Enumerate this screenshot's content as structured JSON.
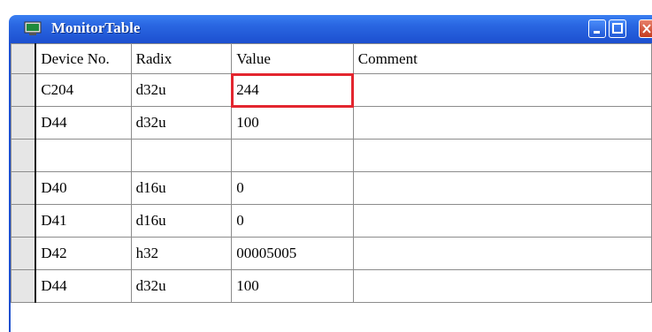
{
  "window": {
    "title": "MonitorTable",
    "accent": "#2a67e2"
  },
  "columns": [
    "Device No.",
    "Radix",
    "Value",
    "Comment"
  ],
  "rows": [
    {
      "device": "C204",
      "radix": "d32u",
      "value": "244",
      "comment": ""
    },
    {
      "device": "D44",
      "radix": "d32u",
      "value": "100",
      "comment": ""
    },
    {
      "device": "",
      "radix": "",
      "value": "",
      "comment": ""
    },
    {
      "device": "D40",
      "radix": "d16u",
      "value": "0",
      "comment": ""
    },
    {
      "device": "D41",
      "radix": "d16u",
      "value": "0",
      "comment": ""
    },
    {
      "device": "D42",
      "radix": "h32",
      "value": "00005005",
      "comment": ""
    },
    {
      "device": "D44",
      "radix": "d32u",
      "value": "100",
      "comment": ""
    }
  ],
  "highlight_color": "#e3262f"
}
